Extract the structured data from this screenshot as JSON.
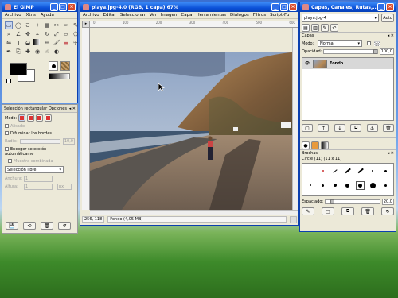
{
  "gimp_toolbox": {
    "title": "El GIMP",
    "menu": [
      "Archivo",
      "Xtns",
      "Ayuda"
    ]
  },
  "tool_options": {
    "header": "Selección rectangular Opciones",
    "mode_label": "Modo:",
    "antialias": "Alisado",
    "feather": "Difuminar los bordes",
    "radius_label": "Radio:",
    "radius_value": "10,0",
    "auto_shrink": "Encoger selección automáticame",
    "merged": "Muestra combinada",
    "select_mode": "Selección libre",
    "width_label": "Anchura:",
    "height_label": "Altura:",
    "dim_value": "1",
    "unit": "px"
  },
  "image_window": {
    "title": "playa.jpg-4.0 (RGB, 1 capa) 67%",
    "menu": [
      "Archivo",
      "Editar",
      "Seleccionar",
      "Ver",
      "Imagen",
      "Capa",
      "Herramientas",
      "Diálogos",
      "Filtros",
      "Script-Fu"
    ],
    "ruler_ticks": [
      "0",
      "100",
      "200",
      "300",
      "400",
      "500",
      "600"
    ],
    "coords": "256, 118",
    "status": "Fondo (4,05 MB)"
  },
  "layers_dialog": {
    "title": "Capas, Canales, Rutas,...",
    "image_select": "playa.jpg-4",
    "auto_label": "Auto",
    "section": "Capas",
    "mode_label": "Modo:",
    "mode_value": "Normal",
    "opacity_label": "Opacidad:",
    "opacity_value": "100,0",
    "layer_name": "Fondo"
  },
  "brushes_dialog": {
    "section": "Brochas",
    "brush_info": "Circle (11) (11 x 11)",
    "spacing_label": "Espaciado:",
    "spacing_value": "20,0"
  },
  "icons": {
    "close": "close-icon",
    "minimize": "minimize-icon",
    "maximize": "maximize-icon"
  }
}
